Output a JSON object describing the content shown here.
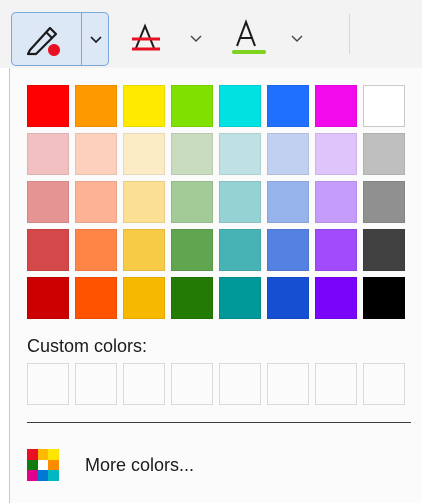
{
  "toolbar": {
    "highlight_button": {
      "icon": "highlighter-icon",
      "dot_color": "#e81123",
      "selected": true
    },
    "highlight_dropdown": {
      "icon": "chevron-down-icon"
    },
    "strikethrough_button": {
      "icon": "strikethrough-color-icon",
      "underline_color": "#e81123"
    },
    "strikethrough_dropdown": {
      "icon": "chevron-down-icon"
    },
    "font_color_button": {
      "icon": "font-color-icon",
      "underline_color": "#7fd21d"
    },
    "font_color_dropdown": {
      "icon": "chevron-down-icon"
    }
  },
  "palette": {
    "rows": [
      [
        "#ff0000",
        "#ff9900",
        "#ffea00",
        "#80e000",
        "#00e1e1",
        "#1f70ff",
        "#f20aed",
        "#ffffff"
      ],
      [
        "#f2c0c0",
        "#fdd0bd",
        "#fcecc6",
        "#cadcbf",
        "#bfe1e3",
        "#c1cff0",
        "#dfc4fb",
        "#bfbfbf"
      ],
      [
        "#e69393",
        "#fdb393",
        "#fbe094",
        "#a2cb97",
        "#95d2d4",
        "#97b3ec",
        "#c59bfb",
        "#909090"
      ],
      [
        "#d44849",
        "#ff8547",
        "#f7cb46",
        "#60a54f",
        "#47b3b4",
        "#5581e2",
        "#a14bfc",
        "#414141"
      ],
      [
        "#cc0000",
        "#ff5300",
        "#f6b900",
        "#237b05",
        "#00999a",
        "#174fd2",
        "#7a04f9",
        "#000000"
      ]
    ]
  },
  "custom": {
    "label": "Custom colors:",
    "slots": [
      "",
      "",
      "",
      "",
      "",
      "",
      "",
      ""
    ]
  },
  "more_colors": {
    "label": "More colors...",
    "icon": "color-palette-icon",
    "icon_colors": [
      "#e81123",
      "#ffb900",
      "#ffe600",
      "#107c10",
      "#ffffff",
      "#ff8c00",
      "#e3008c",
      "#0078d4",
      "#00b7c3"
    ]
  }
}
